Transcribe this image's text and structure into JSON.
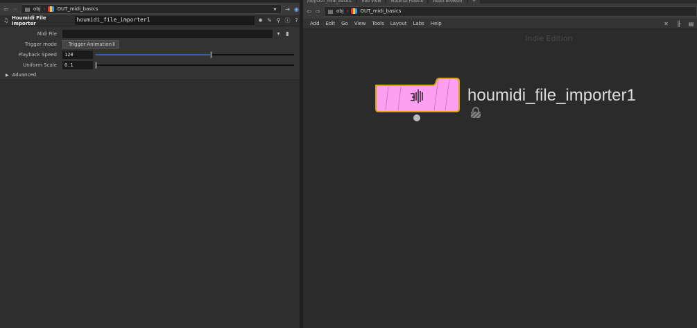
{
  "left": {
    "path": {
      "root": "obj",
      "node": "OUT_midi_basics"
    },
    "header": {
      "type_label": "Houmidi File Importer",
      "node_name": "houmidi_file_importer1"
    },
    "params": [
      {
        "label": "Midi File",
        "value": ""
      },
      {
        "label": "Trigger mode",
        "value": "Trigger Animation"
      },
      {
        "label": "Playback Speed",
        "value": "120",
        "slider_fraction": 0.58
      },
      {
        "label": "Uniform Scale",
        "value": "0.1",
        "slider_fraction": 0.0
      }
    ],
    "advanced": "Advanced"
  },
  "right": {
    "tabs": [
      "/obj/OUT_midi_basics",
      "Tree View",
      "Material Palette",
      "Asset Browser",
      "+"
    ],
    "path": {
      "root": "obj",
      "node": "OUT_midi_basics"
    },
    "menu": [
      "Add",
      "Edit",
      "Go",
      "View",
      "Tools",
      "Layout",
      "Labs",
      "Help"
    ],
    "watermark": "Indie Edition",
    "node": {
      "name": "houmidi_file_importer1",
      "color": "#ff9ff2",
      "outline": "#d4a800"
    }
  }
}
